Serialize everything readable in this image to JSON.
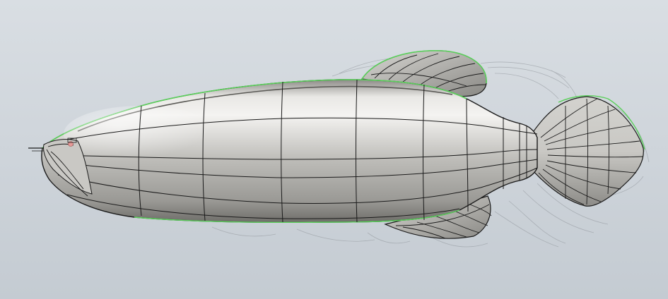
{
  "scene": {
    "subject": "fish-surface-model",
    "colors": {
      "background_top": "#d8dde2",
      "background_bottom": "#c2c9d0",
      "body_light": "#f2f2f0",
      "body_mid": "#bdbcb8",
      "body_dark": "#7f7e7a",
      "fin_fill": "#b8b7b3",
      "wire": "#1a1a1a",
      "edge_highlight": "#5bd05b",
      "sketch_line": "#8f949a"
    }
  }
}
